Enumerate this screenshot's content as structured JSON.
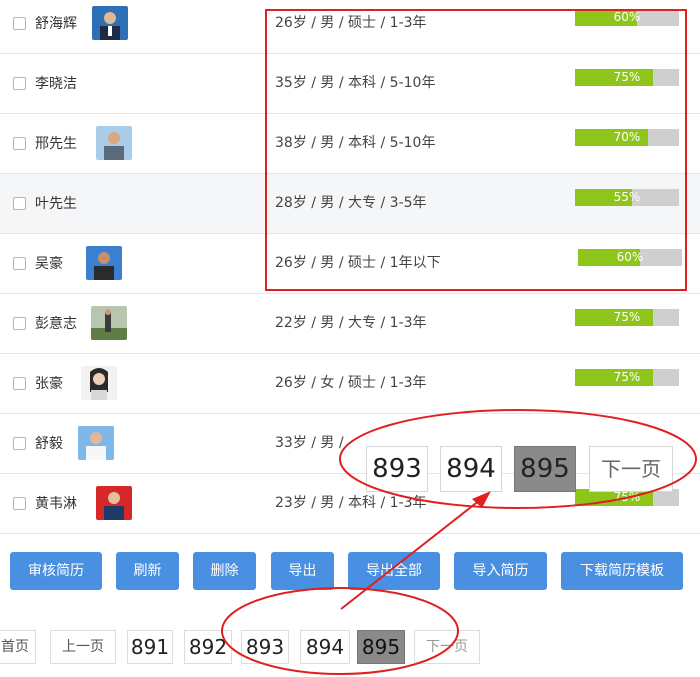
{
  "candidates": [
    {
      "name": "舒海辉",
      "info": "26岁 / 男 / 硕士 / 1-3年",
      "match": "60%",
      "match_value": 0.6,
      "avatar": "photo-avatar"
    },
    {
      "name": "李晓洁",
      "info": "35岁 / 男 / 本科 / 5-10年",
      "match": "75%",
      "match_value": 0.75,
      "avatar": ""
    },
    {
      "name": "邢先生",
      "info": "38岁 / 男 / 本科 / 5-10年",
      "match": "70%",
      "match_value": 0.7,
      "avatar": "photo-avatar"
    },
    {
      "name": "叶先生",
      "info": "28岁 / 男 / 大专 / 3-5年",
      "match": "55%",
      "match_value": 0.55,
      "avatar": ""
    },
    {
      "name": "吴豪",
      "info": "26岁 / 男 / 硕士 / 1年以下",
      "match": "60%",
      "match_value": 0.6,
      "avatar": "photo-avatar"
    },
    {
      "name": "彭意志",
      "info": "22岁 / 男 / 大专 / 1-3年",
      "match": "75%",
      "match_value": 0.75,
      "avatar": "photo-avatar"
    },
    {
      "name": "张豪",
      "info": "26岁 / 女 / 硕士 / 1-3年",
      "match": "75%",
      "match_value": 0.75,
      "avatar": "photo-avatar"
    },
    {
      "name": "舒毅",
      "info": "33岁 / 男 /",
      "match": "",
      "match_value": null,
      "avatar": "photo-avatar"
    },
    {
      "name": "黄韦淋",
      "info": "23岁 / 男 / 本科 / 1-3年",
      "match": "75%",
      "match_value": 0.75,
      "avatar": "photo-avatar"
    }
  ],
  "toolbar": {
    "review": "审核简历",
    "refresh": "刷新",
    "delete": "删除",
    "export": "导出",
    "export_all": "导出全部",
    "import": "导入简历",
    "download_template": "下载简历模板"
  },
  "pager": {
    "first": "首页",
    "prev": "上一页",
    "pages": [
      "891",
      "892",
      "893",
      "894",
      "895"
    ],
    "current": "895",
    "next": "下一页"
  },
  "zoom": {
    "pages": [
      "893",
      "894",
      "895"
    ],
    "current": "895",
    "next": "下一页"
  },
  "colors": {
    "primary_button": "#4a90e2",
    "progress_fill": "#8dc51b",
    "progress_track": "#cfcfcf",
    "annotation": "#e02020",
    "active_page": "#8a8a8a"
  }
}
